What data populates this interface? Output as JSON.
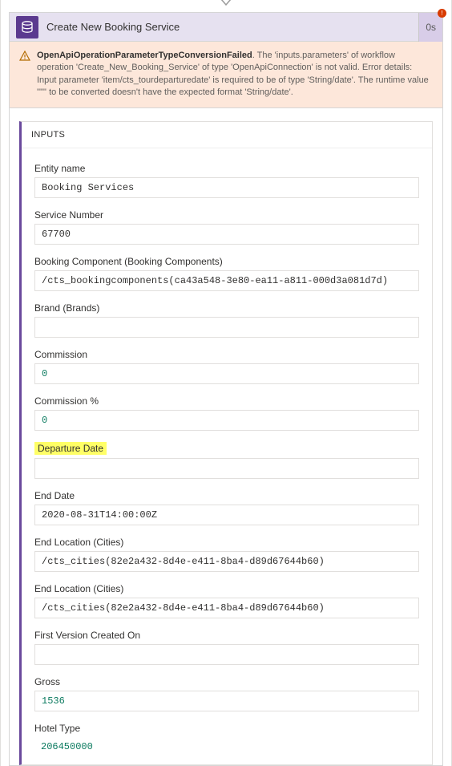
{
  "header": {
    "title": "Create New Booking Service",
    "time": "0s",
    "badge": "!"
  },
  "error": {
    "code": "OpenApiOperationParameterTypeConversionFailed",
    "message": ". The 'inputs.parameters' of workflow operation 'Create_New_Booking_Service' of type 'OpenApiConnection' is not valid. Error details: Input parameter 'item/cts_tourdeparturedate' is required to be of type 'String/date'. The runtime value '\"\"' to be converted doesn't have the expected format 'String/date'."
  },
  "inputsLabel": "INPUTS",
  "fields": {
    "entityName": {
      "label": "Entity name",
      "value": "Booking Services"
    },
    "serviceNumber": {
      "label": "Service Number",
      "value": "67700"
    },
    "bookingComponent": {
      "label": "Booking Component (Booking Components)",
      "value": "/cts_bookingcomponents(ca43a548-3e80-ea11-a811-000d3a081d7d)"
    },
    "brand": {
      "label": "Brand (Brands)",
      "value": ""
    },
    "commission": {
      "label": "Commission",
      "value": "0"
    },
    "commissionPct": {
      "label": "Commission %",
      "value": "0"
    },
    "departureDate": {
      "label": "Departure Date",
      "value": ""
    },
    "endDate": {
      "label": "End Date",
      "value": "2020-08-31T14:00:00Z"
    },
    "endLocation1": {
      "label": "End Location (Cities)",
      "value": "/cts_cities(82e2a432-8d4e-e411-8ba4-d89d67644b60)"
    },
    "endLocation2": {
      "label": "End Location (Cities)",
      "value": "/cts_cities(82e2a432-8d4e-e411-8ba4-d89d67644b60)"
    },
    "firstVersion": {
      "label": "First Version Created On",
      "value": ""
    },
    "gross": {
      "label": "Gross",
      "value": "1536"
    },
    "hotelType": {
      "label": "Hotel Type",
      "value": "206450000"
    }
  }
}
